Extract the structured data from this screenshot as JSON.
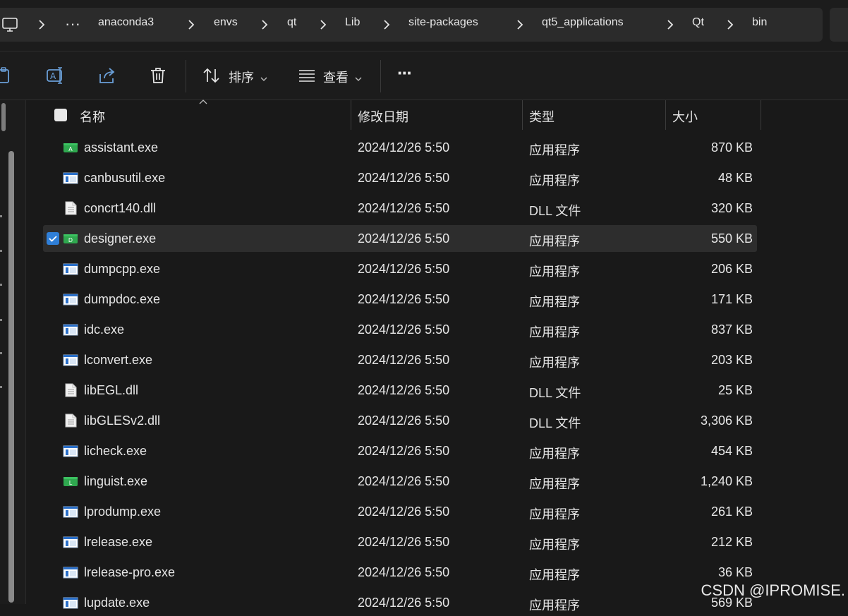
{
  "address_bar": {
    "overflow": "···",
    "crumbs": [
      "anaconda3",
      "envs",
      "qt",
      "Lib",
      "site-packages",
      "qt5_applications",
      "Qt",
      "bin"
    ]
  },
  "toolbar": {
    "sort_label": "排序",
    "view_label": "查看",
    "more_label": "···"
  },
  "columns": {
    "name": "名称",
    "date": "修改日期",
    "type": "类型",
    "size": "大小"
  },
  "files": [
    {
      "name": "assistant.exe",
      "date": "2024/12/26 5:50",
      "type": "应用程序",
      "size": "870 KB",
      "icon": "qt-app-icon-a"
    },
    {
      "name": "canbusutil.exe",
      "date": "2024/12/26 5:50",
      "type": "应用程序",
      "size": "48 KB",
      "icon": "exe-icon"
    },
    {
      "name": "concrt140.dll",
      "date": "2024/12/26 5:50",
      "type": "DLL 文件",
      "size": "320 KB",
      "icon": "dll-icon"
    },
    {
      "name": "designer.exe",
      "date": "2024/12/26 5:50",
      "type": "应用程序",
      "size": "550 KB",
      "icon": "qt-app-icon-d",
      "selected": true
    },
    {
      "name": "dumpcpp.exe",
      "date": "2024/12/26 5:50",
      "type": "应用程序",
      "size": "206 KB",
      "icon": "exe-icon"
    },
    {
      "name": "dumpdoc.exe",
      "date": "2024/12/26 5:50",
      "type": "应用程序",
      "size": "171 KB",
      "icon": "exe-icon"
    },
    {
      "name": "idc.exe",
      "date": "2024/12/26 5:50",
      "type": "应用程序",
      "size": "837 KB",
      "icon": "exe-icon"
    },
    {
      "name": "lconvert.exe",
      "date": "2024/12/26 5:50",
      "type": "应用程序",
      "size": "203 KB",
      "icon": "exe-icon"
    },
    {
      "name": "libEGL.dll",
      "date": "2024/12/26 5:50",
      "type": "DLL 文件",
      "size": "25 KB",
      "icon": "dll-icon"
    },
    {
      "name": "libGLESv2.dll",
      "date": "2024/12/26 5:50",
      "type": "DLL 文件",
      "size": "3,306 KB",
      "icon": "dll-icon"
    },
    {
      "name": "licheck.exe",
      "date": "2024/12/26 5:50",
      "type": "应用程序",
      "size": "454 KB",
      "icon": "exe-icon"
    },
    {
      "name": "linguist.exe",
      "date": "2024/12/26 5:50",
      "type": "应用程序",
      "size": "1,240 KB",
      "icon": "qt-app-icon-l"
    },
    {
      "name": "lprodump.exe",
      "date": "2024/12/26 5:50",
      "type": "应用程序",
      "size": "261 KB",
      "icon": "exe-icon"
    },
    {
      "name": "lrelease.exe",
      "date": "2024/12/26 5:50",
      "type": "应用程序",
      "size": "212 KB",
      "icon": "exe-icon"
    },
    {
      "name": "lrelease-pro.exe",
      "date": "2024/12/26 5:50",
      "type": "应用程序",
      "size": "36 KB",
      "icon": "exe-icon"
    },
    {
      "name": "lupdate.exe",
      "date": "2024/12/26 5:50",
      "type": "应用程序",
      "size": "569 KB",
      "icon": "exe-icon"
    }
  ],
  "watermark": "CSDN @IPROMISE.",
  "colors": {
    "background": "#191919",
    "selection": "#2d2d2d",
    "checkbox_accent": "#2f7fd8",
    "qt_green": "#2fa84f"
  }
}
